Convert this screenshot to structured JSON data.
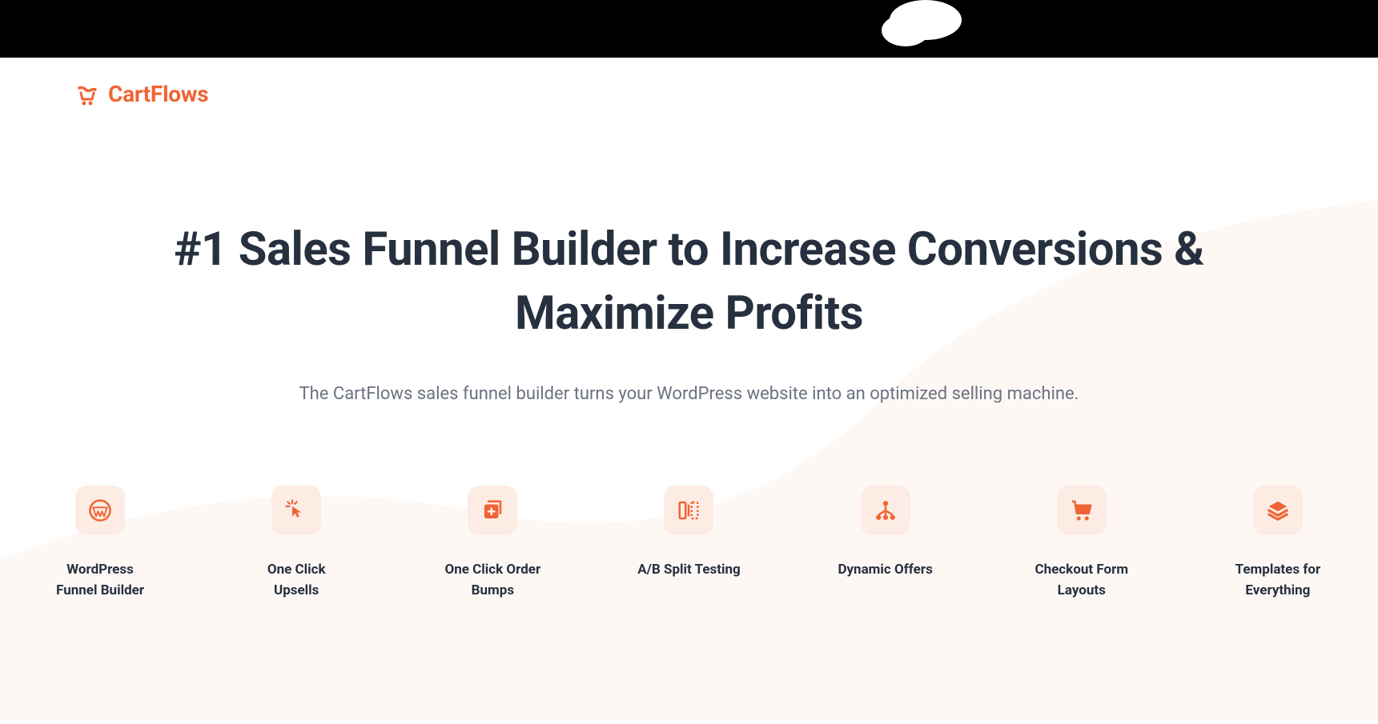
{
  "brand": {
    "name": "CartFlows"
  },
  "hero": {
    "title": "#1 Sales Funnel Builder to Increase Conversions & Maximize Profits",
    "subtitle": "The CartFlows sales funnel builder turns your WordPress website into an optimized selling machine."
  },
  "features": [
    {
      "icon": "wordpress-icon",
      "label": "WordPress Funnel Builder"
    },
    {
      "icon": "cursor-click-icon",
      "label": "One Click Upsells"
    },
    {
      "icon": "plus-box-icon",
      "label": "One Click Order Bumps"
    },
    {
      "icon": "ab-test-icon",
      "label": "A/B Split Testing"
    },
    {
      "icon": "hierarchy-icon",
      "label": "Dynamic Offers"
    },
    {
      "icon": "cart-icon",
      "label": "Checkout Form Layouts"
    },
    {
      "icon": "layers-icon",
      "label": "Templates for Everything"
    }
  ]
}
